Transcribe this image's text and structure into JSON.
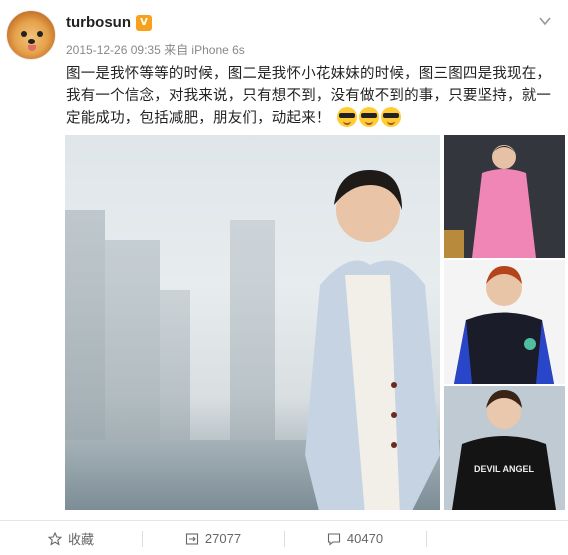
{
  "user": {
    "name": "turbosun",
    "vip_badge": "V"
  },
  "post": {
    "timestamp": "2015-12-26 09:35",
    "source": "来自 iPhone 6s",
    "text": "图一是我怀等等的时候，图二是我怀小花妹妹的时候，图三图四是我现在，我有一个信念，对我来说，只有想不到，没有做不到的事，只要坚持，就一定能成功，包括减肥，朋友们，动起来！",
    "emojis": [
      "sunglasses-emoji",
      "sunglasses-emoji",
      "sunglasses-emoji"
    ]
  },
  "photos": {
    "side_caption": "DEVIL ANGEL"
  },
  "actions": {
    "favorite_label": "收藏",
    "repost_count": "27077",
    "comment_count": "40470",
    "like_count": ""
  },
  "colors": {
    "username": "#222222",
    "meta": "#888888",
    "vip": "#f6a21c",
    "action_text": "#666666"
  }
}
